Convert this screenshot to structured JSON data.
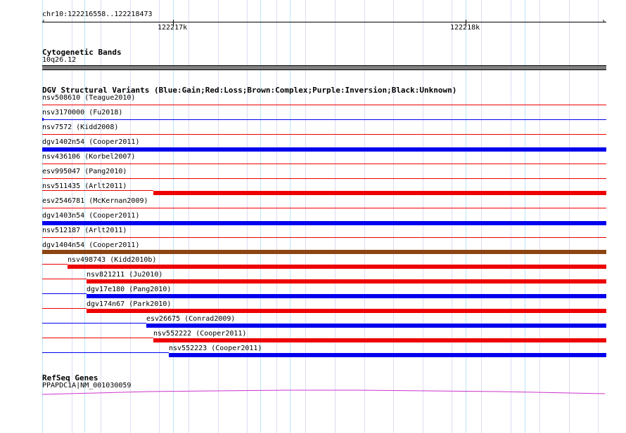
{
  "ruler": {
    "locus": "chr10:122216558..122218473",
    "ticks": [
      "122217k",
      "122218k"
    ]
  },
  "cytoband": {
    "title": "Cytogenetic Bands",
    "band": "10q26.12",
    "color": "#808080"
  },
  "dgv": {
    "title": "DGV Structural Variants (Blue:Gain;Red:Loss;Brown:Complex;Purple:Inversion;Black:Unknown)",
    "colors": {
      "gain": "#0000ee",
      "loss": "#ee0000",
      "complex": "#8b4513"
    },
    "variants": [
      {
        "label": "nsv508610 (Teague2010)",
        "type": "loss"
      },
      {
        "label": "nsv3170000 (Fu2018)",
        "type": "gain"
      },
      {
        "label": "nsv7572 (Kidd2008)",
        "type": "loss"
      },
      {
        "label": "dgv1402n54 (Cooper2011)",
        "type": "gain"
      },
      {
        "label": "nsv436106 (Korbel2007)",
        "type": "loss"
      },
      {
        "label": "esv995047 (Pang2010)",
        "type": "loss"
      },
      {
        "label": "nsv511435 (Arlt2011)",
        "type": "loss"
      },
      {
        "label": "esv2546781 (McKernan2009)",
        "type": "loss"
      },
      {
        "label": "dgv1403n54 (Cooper2011)",
        "type": "gain"
      },
      {
        "label": "nsv512187 (Arlt2011)",
        "type": "loss"
      },
      {
        "label": "dgv1404n54 (Cooper2011)",
        "type": "complex"
      },
      {
        "label": "nsv498743 (Kidd2010b)",
        "type": "loss"
      },
      {
        "label": "nsv821211 (Ju2010)",
        "type": "loss"
      },
      {
        "label": "dgv17e180 (Pang2010)",
        "type": "gain"
      },
      {
        "label": "dgv174n67 (Park2010)",
        "type": "loss"
      },
      {
        "label": "esv26675 (Conrad2009)",
        "type": "gain"
      },
      {
        "label": "nsv552222 (Cooper2011)",
        "type": "loss"
      },
      {
        "label": "nsv552223 (Cooper2011)",
        "type": "gain"
      }
    ]
  },
  "refseq": {
    "title": "RefSeq Genes",
    "gene": "PPAPDC1A|NM_001030059",
    "color": "#cc33cc"
  }
}
